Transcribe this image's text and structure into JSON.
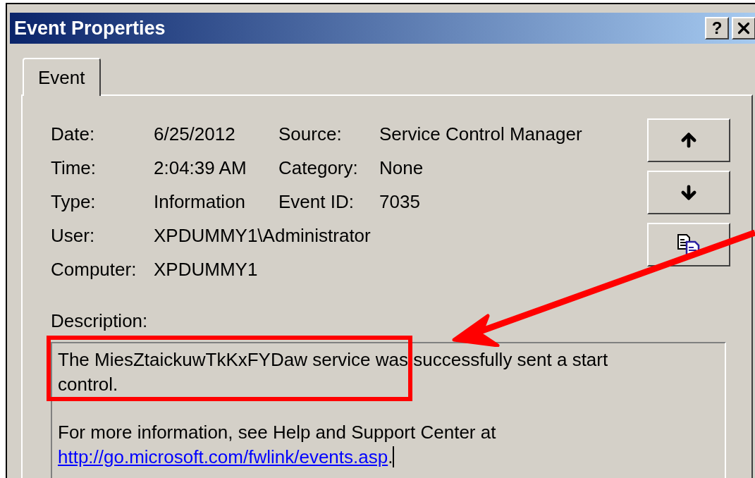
{
  "window": {
    "title": "Event Properties",
    "help_button": "?"
  },
  "tabs": [
    {
      "label": "Event",
      "selected": true
    }
  ],
  "fields": [
    {
      "label": "Date:",
      "value": "6/25/2012",
      "label_2": "Source:",
      "value_2": "Service Control Manager"
    },
    {
      "label": "Time:",
      "value": "2:04:39 AM",
      "label_2": "Category:",
      "value_2": "None"
    },
    {
      "label": "Type:",
      "value": "Information",
      "label_2": "Event ID:",
      "value_2": "7035"
    },
    {
      "label": "User:",
      "value": "XPDUMMY1\\Administrator"
    },
    {
      "label": "Computer:",
      "value": "XPDUMMY1"
    }
  ],
  "nav_buttons": [
    {
      "kind": "up"
    },
    {
      "kind": "down"
    },
    {
      "kind": "copy"
    }
  ],
  "description": {
    "label": "Description:",
    "text": "The MiesZtaickuwTkKxFYDaw service was successfully sent a start control.",
    "more": "For more information, see Help and Support Center at",
    "link": "http://go.microsoft.com/fwlink/events.asp",
    "link_end": "."
  },
  "highlight_box": {
    "color": "#ff0000"
  },
  "pointer_arrow": {
    "color": "#ff0000"
  }
}
